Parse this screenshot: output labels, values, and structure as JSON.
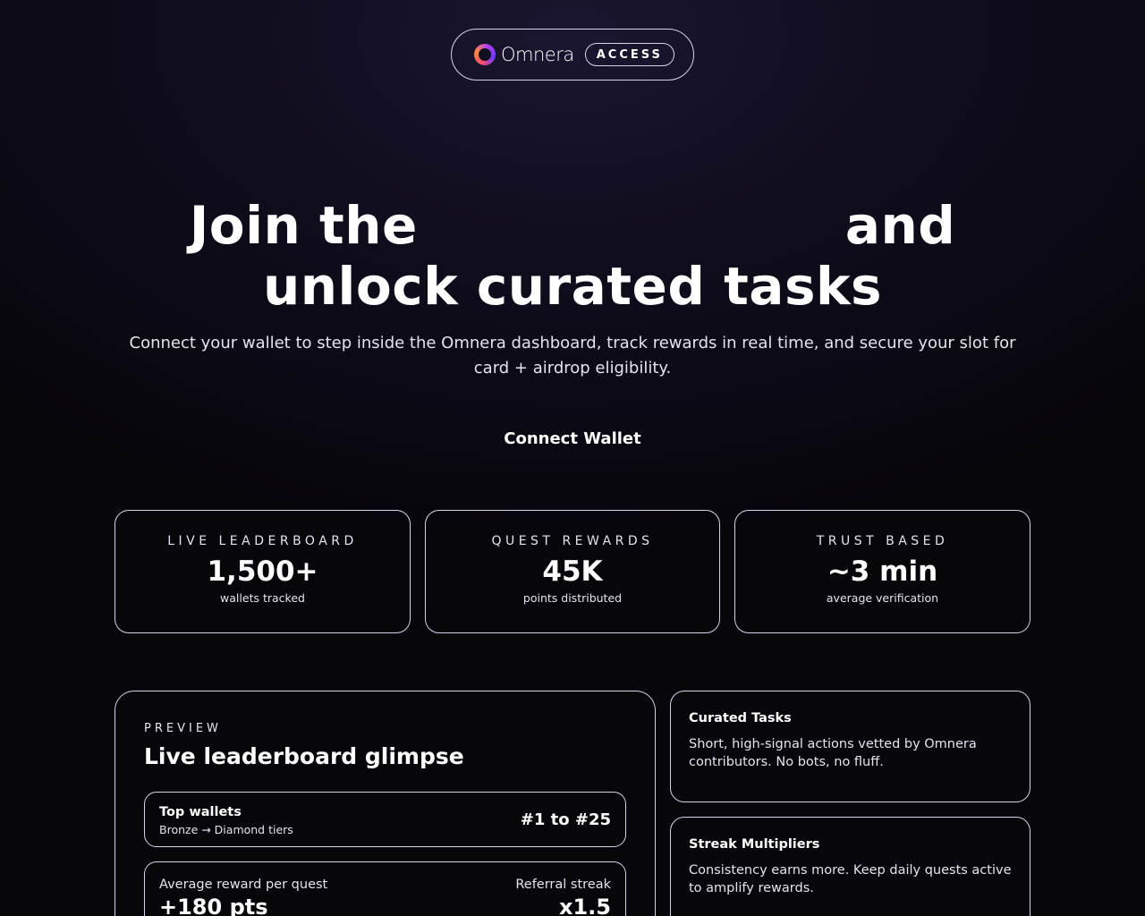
{
  "header": {
    "brand": "Omnera",
    "badge": "ACCESS"
  },
  "hero": {
    "title_part1": "Join the",
    "title_part2": "and",
    "title_line2": "unlock curated tasks",
    "subtitle": "Connect your wallet to step inside the Omnera dashboard, track rewards in real time, and secure your slot for card + airdrop eligibility.",
    "cta_label": "Connect Wallet"
  },
  "stats": [
    {
      "label": "LIVE LEADERBOARD",
      "value": "1,500+",
      "caption": "wallets tracked"
    },
    {
      "label": "QUEST REWARDS",
      "value": "45K",
      "caption": "points distributed"
    },
    {
      "label": "TRUST BASED",
      "value": "~3 min",
      "caption": "average verification"
    }
  ],
  "preview": {
    "kicker": "PREVIEW",
    "title": "Live leaderboard glimpse",
    "top_wallets": {
      "title": "Top wallets",
      "subtitle": "Bronze → Diamond tiers",
      "range": "#1 to #25"
    },
    "metrics": {
      "left_label": "Average reward per quest",
      "left_value": "+180 pts",
      "right_label": "Referral streak",
      "right_value": "x1.5"
    }
  },
  "features": [
    {
      "title": "Curated Tasks",
      "description": "Short, high-signal actions vetted by Omnera contributors. No bots, no fluff."
    },
    {
      "title": "Streak Multipliers",
      "description": "Consistency earns more. Keep daily quests active to amplify rewards."
    }
  ]
}
